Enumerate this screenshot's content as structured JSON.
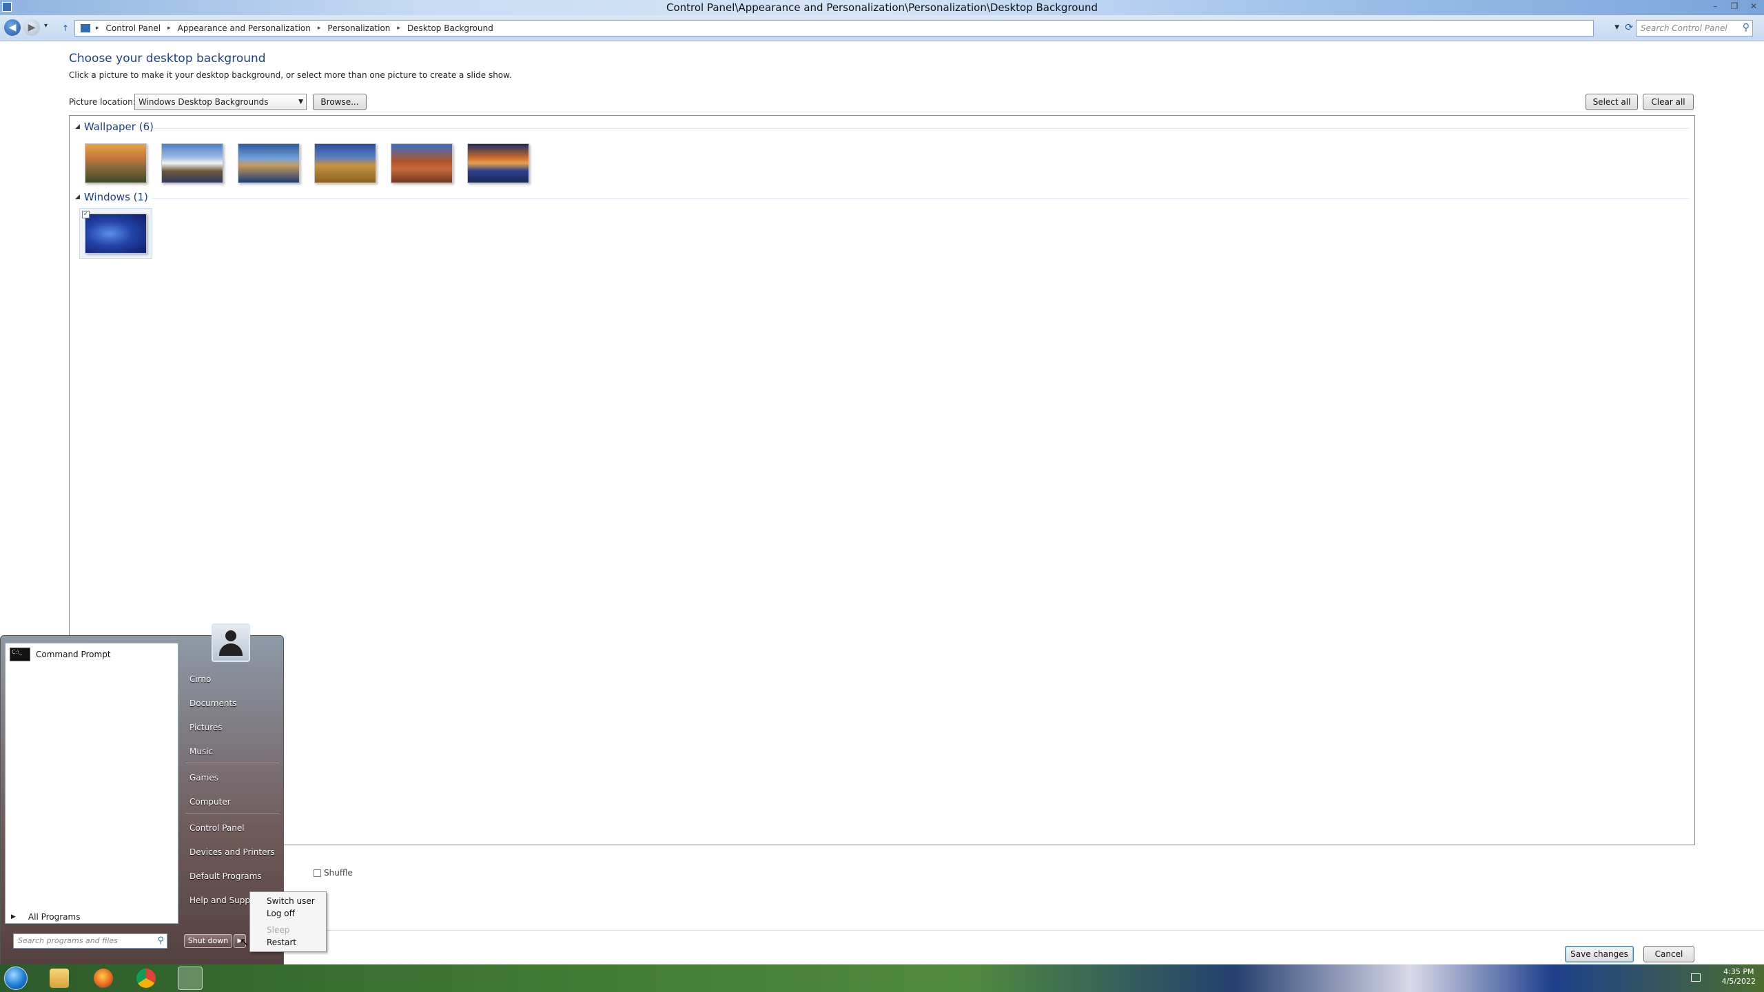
{
  "window": {
    "title": "Control Panel\\Appearance and Personalization\\Personalization\\Desktop Background",
    "minimize": "–",
    "restore": "❐",
    "close": "✕"
  },
  "address": {
    "crumbs": [
      "Control Panel",
      "Appearance and Personalization",
      "Personalization",
      "Desktop Background"
    ],
    "search_placeholder": "Search Control Panel"
  },
  "page": {
    "heading": "Choose your desktop background",
    "subtext": "Click a picture to make it your desktop background, or select more than one picture to create a slide show.",
    "location_label": "Picture location:",
    "location_value": "Windows Desktop Backgrounds",
    "browse_label": "Browse...",
    "select_all_label": "Select all",
    "clear_all_label": "Clear all",
    "groups": [
      {
        "title": "Wallpaper (6)",
        "images": [
          "sunset-landscape",
          "lighthouse",
          "rock-arch-lake",
          "hay-bale",
          "desert-arch",
          "lake-sunset"
        ]
      },
      {
        "title": "Windows (1)",
        "images": [
          "windows-default"
        ],
        "selected": 0
      }
    ],
    "shuffle_label": "Shuffle",
    "save_label": "Save changes",
    "cancel_label": "Cancel"
  },
  "start_menu": {
    "pinned": [
      {
        "label": "Command Prompt",
        "icon": "command-prompt-icon"
      }
    ],
    "all_programs_label": "All Programs",
    "search_placeholder": "Search programs and files",
    "right_items": [
      "Cirno",
      "Documents",
      "Pictures",
      "Music",
      "Games",
      "Computer",
      "Control Panel",
      "Devices and Printers",
      "Default Programs",
      "Help and Support"
    ],
    "shutdown_label": "Shut down",
    "power_menu": [
      {
        "label": "Switch user",
        "enabled": true
      },
      {
        "label": "Log off",
        "enabled": true
      },
      {
        "label": "Sleep",
        "enabled": false
      },
      {
        "label": "Restart",
        "enabled": true
      }
    ]
  },
  "taskbar": {
    "apps": [
      "windows-explorer-icon",
      "firefox-icon",
      "chrome-icon",
      "control-panel-icon"
    ],
    "time": "4:35 PM",
    "date": "4/5/2022"
  }
}
